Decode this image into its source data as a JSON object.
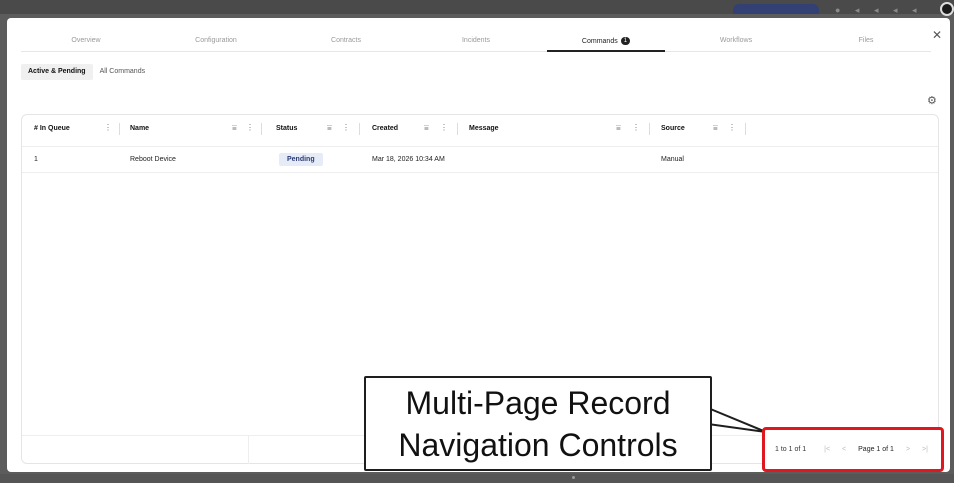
{
  "tabs": [
    {
      "label": "Overview"
    },
    {
      "label": "Configuration"
    },
    {
      "label": "Contracts"
    },
    {
      "label": "Incidents"
    },
    {
      "label": "Commands",
      "badge": "1"
    },
    {
      "label": "Workflows"
    },
    {
      "label": "Files"
    }
  ],
  "subtabs": {
    "active": "Active & Pending",
    "all": "All Commands"
  },
  "columns": {
    "queue": "# In Queue",
    "name": "Name",
    "status": "Status",
    "created": "Created",
    "message": "Message",
    "source": "Source"
  },
  "rows": [
    {
      "queue": "1",
      "name": "Reboot Device",
      "status": "Pending",
      "created": "Mar 18, 2026 10:34 AM",
      "message": "",
      "source": "Manual"
    }
  ],
  "pager": {
    "range": "1 to 1 of 1",
    "page": "Page 1 of 1"
  },
  "callout": {
    "line1": "Multi-Page Record",
    "line2": "Navigation Controls"
  },
  "icons": {
    "close": "close-icon",
    "settings": "gear-icon",
    "filter": "filter-icon",
    "menu": "kebab-icon"
  },
  "colors": {
    "highlight": "#e0171f",
    "status_bg": "#e6ecf7",
    "status_text": "#2b3a73"
  }
}
